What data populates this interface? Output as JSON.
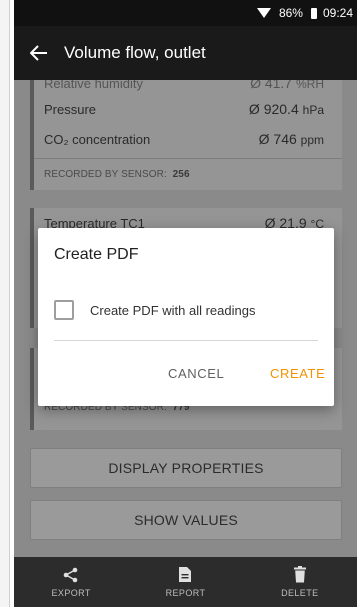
{
  "status_bar": {
    "battery": "86%",
    "time": "09:24",
    "icons": [
      "wifi-icon",
      "battery-icon"
    ]
  },
  "app_bar": {
    "back_icon": "arrow-left-icon",
    "title": "Volume flow, outlet"
  },
  "card1": {
    "partial_row": {
      "label": "Relative humidity",
      "value": "Ø 41.7",
      "unit": "%RH"
    },
    "rows": [
      {
        "label": "Pressure",
        "value": "Ø 920.4",
        "unit": "hPa"
      },
      {
        "label": "CO₂ concentration",
        "value": "Ø 746",
        "unit": "ppm"
      }
    ],
    "recorded_label": "RECORDED BY SENSOR:",
    "recorded_value": "256"
  },
  "card2": {
    "partial_row": {
      "label": "Temperature TC1",
      "value": "Ø 21.9",
      "unit": "°C"
    }
  },
  "card3": {
    "recorded_label": "RECORDED BY SENSOR:",
    "recorded_value": "779"
  },
  "buttons": {
    "display_properties": "DISPLAY PROPERTIES",
    "show_values": "SHOW VALUES"
  },
  "bottom_bar": {
    "export": "EXPORT",
    "report": "REPORT",
    "delete": "DELETE"
  },
  "dialog": {
    "title": "Create PDF",
    "checkbox_label": "Create PDF with all readings",
    "checkbox_checked": false,
    "cancel": "CANCEL",
    "create": "CREATE",
    "accent_color": "#f39200"
  }
}
